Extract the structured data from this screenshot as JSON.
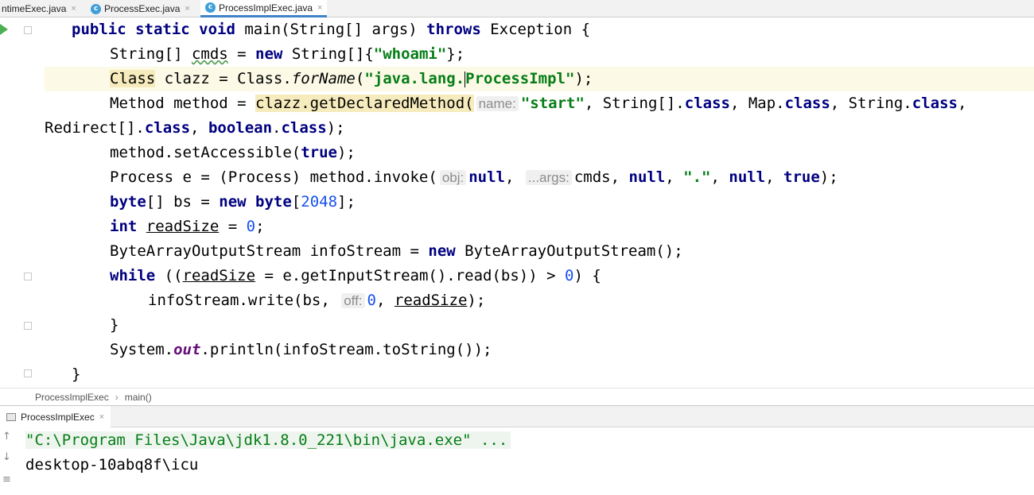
{
  "tabs": [
    {
      "label": "ntimeExec.java",
      "active": false,
      "icon": false
    },
    {
      "label": "ProcessExec.java",
      "active": false,
      "icon": true
    },
    {
      "label": "ProcessImplExec.java",
      "active": true,
      "icon": true
    }
  ],
  "tab_close_glyph": "×",
  "hints": {
    "name": "name:",
    "obj": "obj:",
    "args": "...args:",
    "off": "off:"
  },
  "breadcrumb": {
    "class_name": "ProcessImplExec",
    "separator": "›",
    "method_name": "main()"
  },
  "run_panel": {
    "tab_label": "ProcessImplExec",
    "close_glyph": "×"
  },
  "console": {
    "command_line": "\"C:\\Program Files\\Java\\jdk1.8.0_221\\bin\\java.exe\" ...",
    "output_line": "desktop-10abq8f\\icu"
  },
  "colors": {
    "keyword": "#000080",
    "string": "#067d17",
    "number": "#1750eb",
    "field": "#660e7a",
    "current_line": "#fcfae6",
    "active_tab_underline": "#4083c9"
  }
}
